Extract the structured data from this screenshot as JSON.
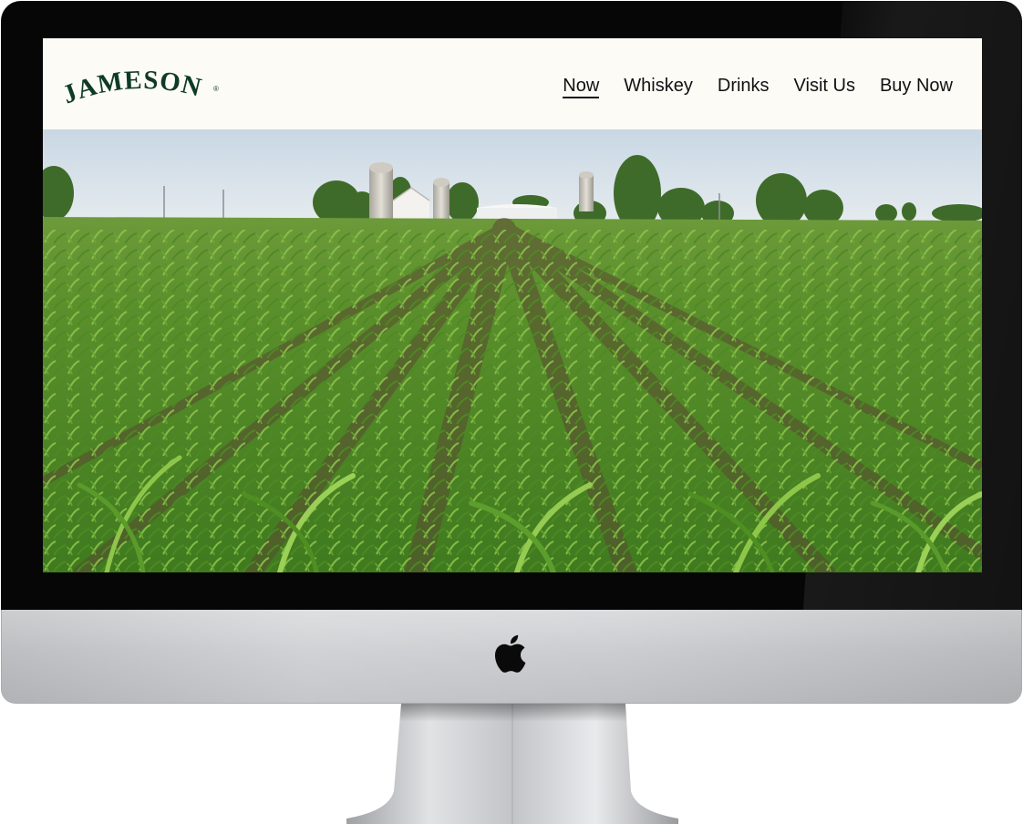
{
  "site": {
    "brand": "JAMESON",
    "brand_mark": "®",
    "brand_color": "#0f3b26",
    "header_background": "#fcfbf6"
  },
  "nav": {
    "items": [
      {
        "label": "Now",
        "active": true
      },
      {
        "label": "Whiskey",
        "active": false
      },
      {
        "label": "Drinks",
        "active": false
      },
      {
        "label": "Visit Us",
        "active": false
      },
      {
        "label": "Buy Now",
        "active": false
      }
    ]
  },
  "hero": {
    "scene": "corn-field-with-farm"
  },
  "device": {
    "logo_icon": "apple-icon"
  }
}
